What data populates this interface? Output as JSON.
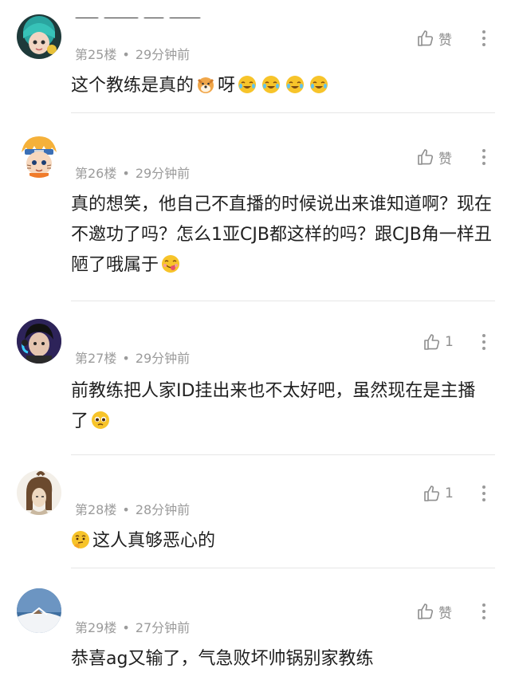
{
  "like_label": "赞",
  "comments": [
    {
      "floor": "第25楼",
      "time": "29分钟前",
      "likes": "赞",
      "text_a": "这个教练是真的",
      "text_b": "呀"
    },
    {
      "floor": "第26楼",
      "time": "29分钟前",
      "likes": "赞",
      "text": "真的想笑，他自己不直播的时候说出来谁知道啊？现在不邀功了吗？怎么1亚CJB都这样的吗？跟CJB角一样丑陋了哦属于"
    },
    {
      "floor": "第27楼",
      "time": "29分钟前",
      "likes": "1",
      "text": "前教练把人家ID挂出来也不太好吧，虽然现在是主播了"
    },
    {
      "floor": "第28楼",
      "time": "28分钟前",
      "likes": "1",
      "text": "这人真够恶心的"
    },
    {
      "floor": "第29楼",
      "time": "27分钟前",
      "likes": "赞",
      "text": "恭喜ag又输了，气急败坏帅锅别家教练"
    }
  ],
  "colors": {
    "meta": "#9b9b9b",
    "text": "#1f1f1f",
    "divider": "#e6e6e6",
    "emoji": "#f7c42a"
  }
}
